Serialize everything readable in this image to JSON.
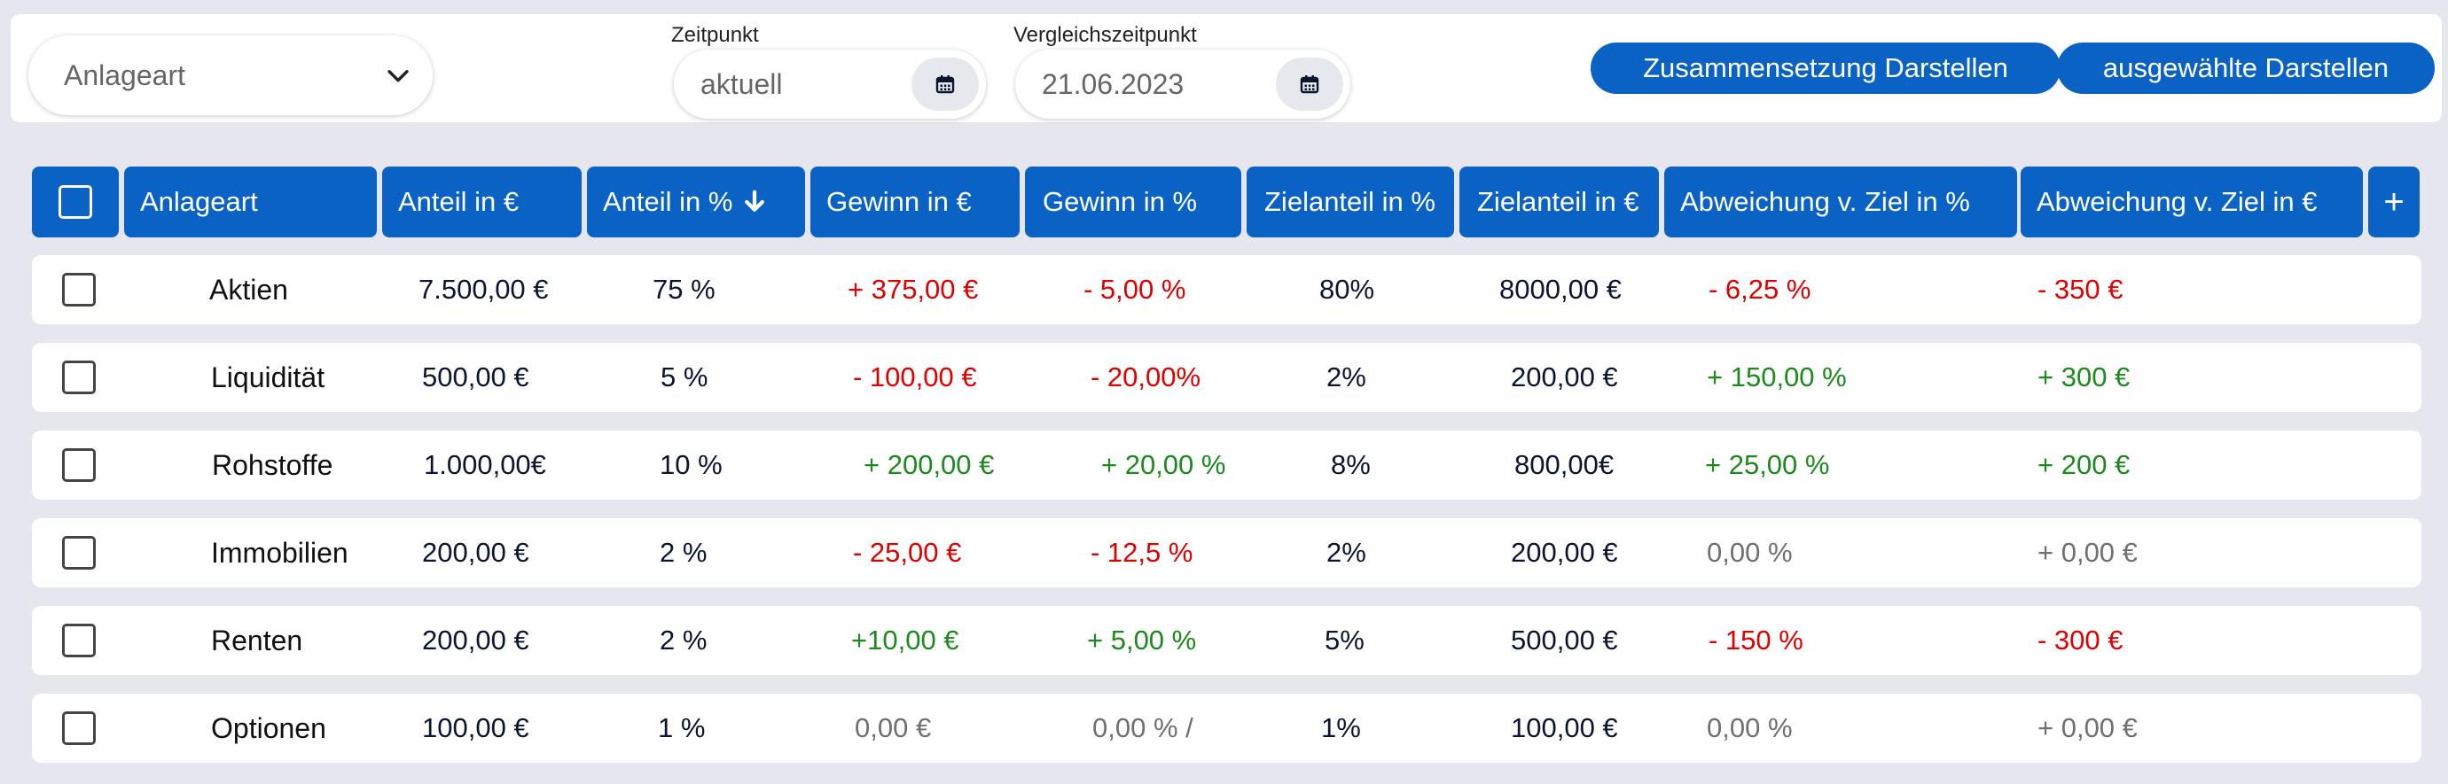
{
  "toolbar": {
    "dropdown_label": "Anlageart",
    "zeitpunkt_label": "Zeitpunkt",
    "zeitpunkt_value": "aktuell",
    "vergleich_label": "Vergleichszeitpunkt",
    "vergleich_value": "21.06.2023",
    "btn_zusammensetzung": "Zusammensetzung Darstellen",
    "btn_ausgewaehlte": "ausgewählte Darstellen"
  },
  "table": {
    "headers": {
      "anlageart": "Anlageart",
      "anteil_eur": "Anteil in €",
      "anteil_pct": "Anteil in %",
      "gewinn_eur": "Gewinn in €",
      "gewinn_pct": "Gewinn in %",
      "zielanteil_pct": "Zielanteil in %",
      "zielanteil_eur": "Zielanteil in €",
      "abweichung_pct": "Abweichung v. Ziel in %",
      "abweichung_eur": "Abweichung v. Ziel in €",
      "add": "+"
    },
    "rows": [
      {
        "name": "Aktien",
        "anteil_eur": "7.500,00 €",
        "anteil_pct": "75 %",
        "gewinn_eur": "+ 375,00 €",
        "gewinn_pct": "- 5,00 %",
        "zielanteil_pct": "80%",
        "zielanteil_eur": "8000,00 €",
        "abweichung_pct": "- 6,25 %",
        "abweichung_eur": "- 350 €"
      },
      {
        "name": "Liquidität",
        "anteil_eur": "500,00 €",
        "anteil_pct": "5 %",
        "gewinn_eur": "- 100,00 €",
        "gewinn_pct": "- 20,00%",
        "zielanteil_pct": "2%",
        "zielanteil_eur": "200,00 €",
        "abweichung_pct": "+ 150,00 %",
        "abweichung_eur": "+ 300 €"
      },
      {
        "name": "Rohstoffe",
        "anteil_eur": "1.000,00€",
        "anteil_pct": "10 %",
        "gewinn_eur": "+ 200,00 €",
        "gewinn_pct": "+ 20,00 %",
        "zielanteil_pct": "8%",
        "zielanteil_eur": "800,00€",
        "abweichung_pct": "+ 25,00 %",
        "abweichung_eur": "+ 200 €"
      },
      {
        "name": "Immobilien",
        "anteil_eur": "200,00 €",
        "anteil_pct": "2 %",
        "gewinn_eur": "- 25,00 €",
        "gewinn_pct": "- 12,5 %",
        "zielanteil_pct": "2%",
        "zielanteil_eur": "200,00 €",
        "abweichung_pct": "0,00 %",
        "abweichung_eur": "+ 0,00 €"
      },
      {
        "name": "Renten",
        "anteil_eur": "200,00 €",
        "anteil_pct": "2 %",
        "gewinn_eur": "+10,00 €",
        "gewinn_pct": "+ 5,00 %",
        "zielanteil_pct": "5%",
        "zielanteil_eur": "500,00 €",
        "abweichung_pct": "- 150 %",
        "abweichung_eur": "- 300 €"
      },
      {
        "name": "Optionen",
        "anteil_eur": "100,00 €",
        "anteil_pct": "1 %",
        "gewinn_eur": "0,00 €",
        "gewinn_pct": "0,00 % /",
        "zielanteil_pct": "1%",
        "zielanteil_eur": "100,00 €",
        "abweichung_pct": "0,00 %",
        "abweichung_eur": "+ 0,00 €"
      }
    ]
  },
  "colors": {
    "accent": "#0a63c4",
    "positive": "#1c8a1c",
    "negative": "#e00000",
    "neutral": "#707070",
    "background": "#e6e6ee"
  },
  "icons": {
    "dropdown": "chevron-down-icon",
    "date_picker": "calendar-icon",
    "sort": "arrow-down-icon",
    "add": "plus-icon"
  }
}
